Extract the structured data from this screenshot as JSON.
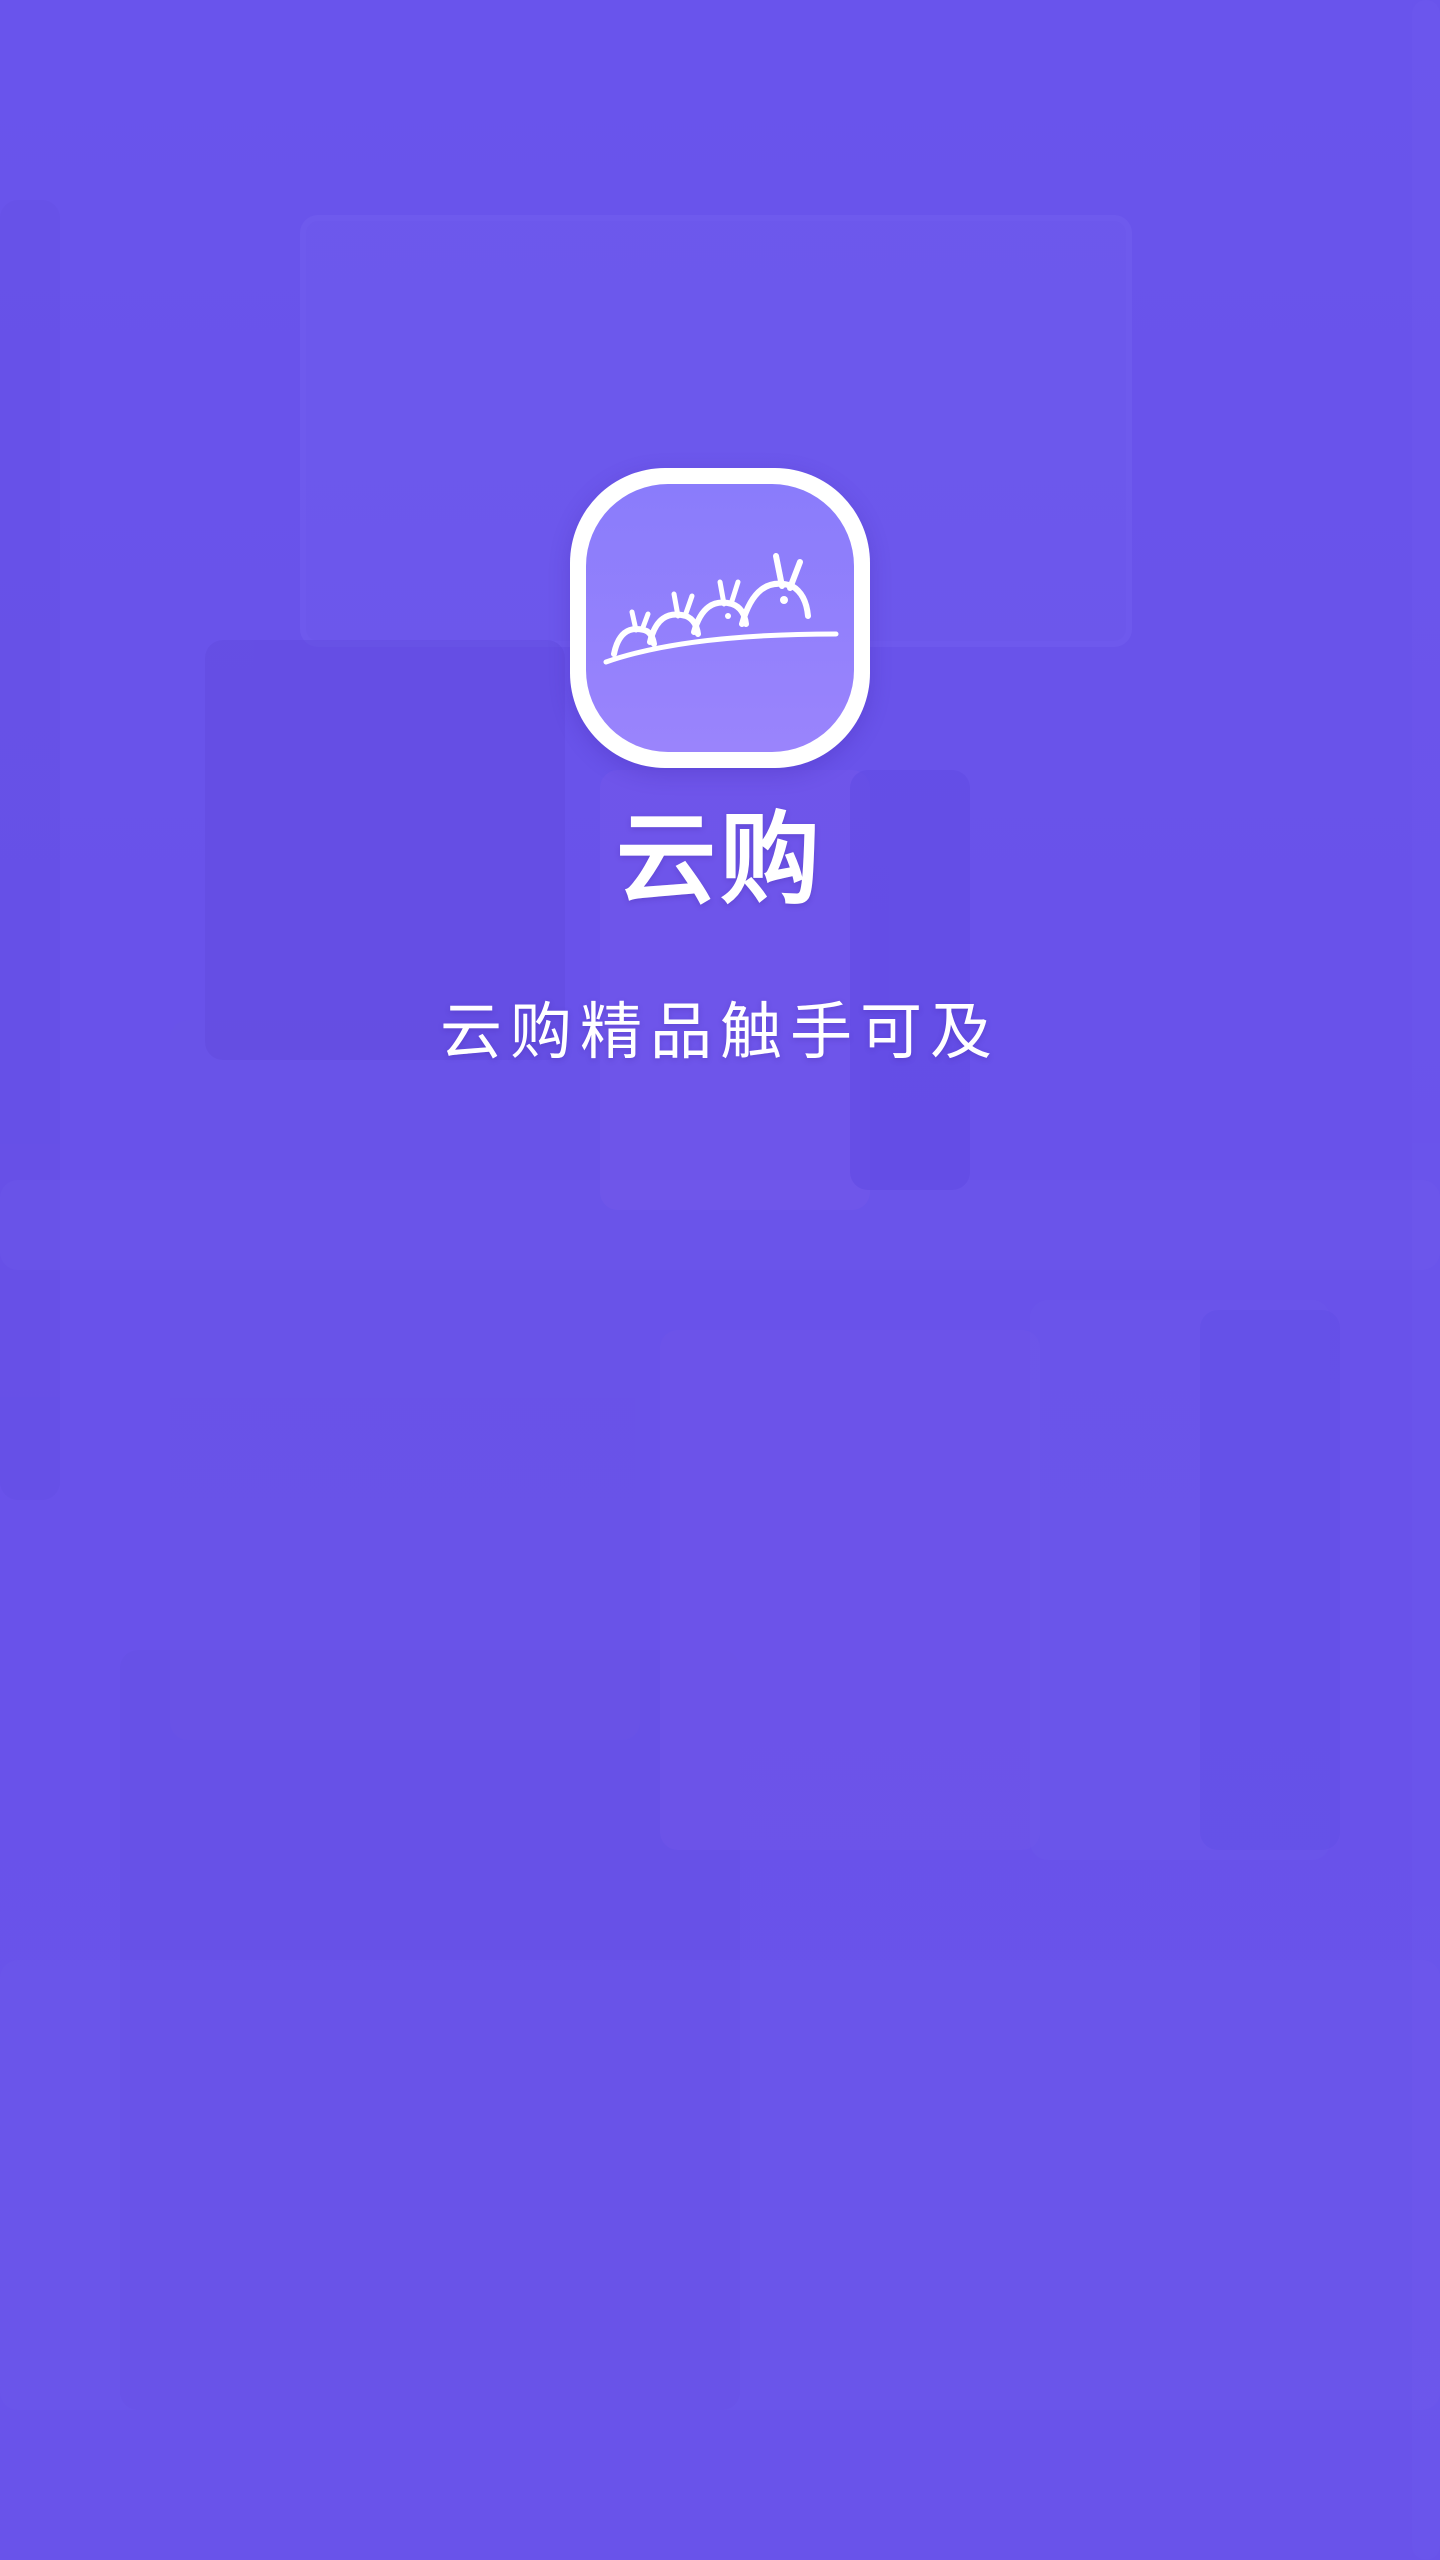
{
  "splash": {
    "app_icon": "cloud-shopping-logo-icon",
    "app_name": "云购",
    "tagline": "云购精品触手可及",
    "colors": {
      "overlay": "#6a55ea",
      "icon_bg": "#8a7cfb",
      "text": "#ffffff"
    }
  }
}
